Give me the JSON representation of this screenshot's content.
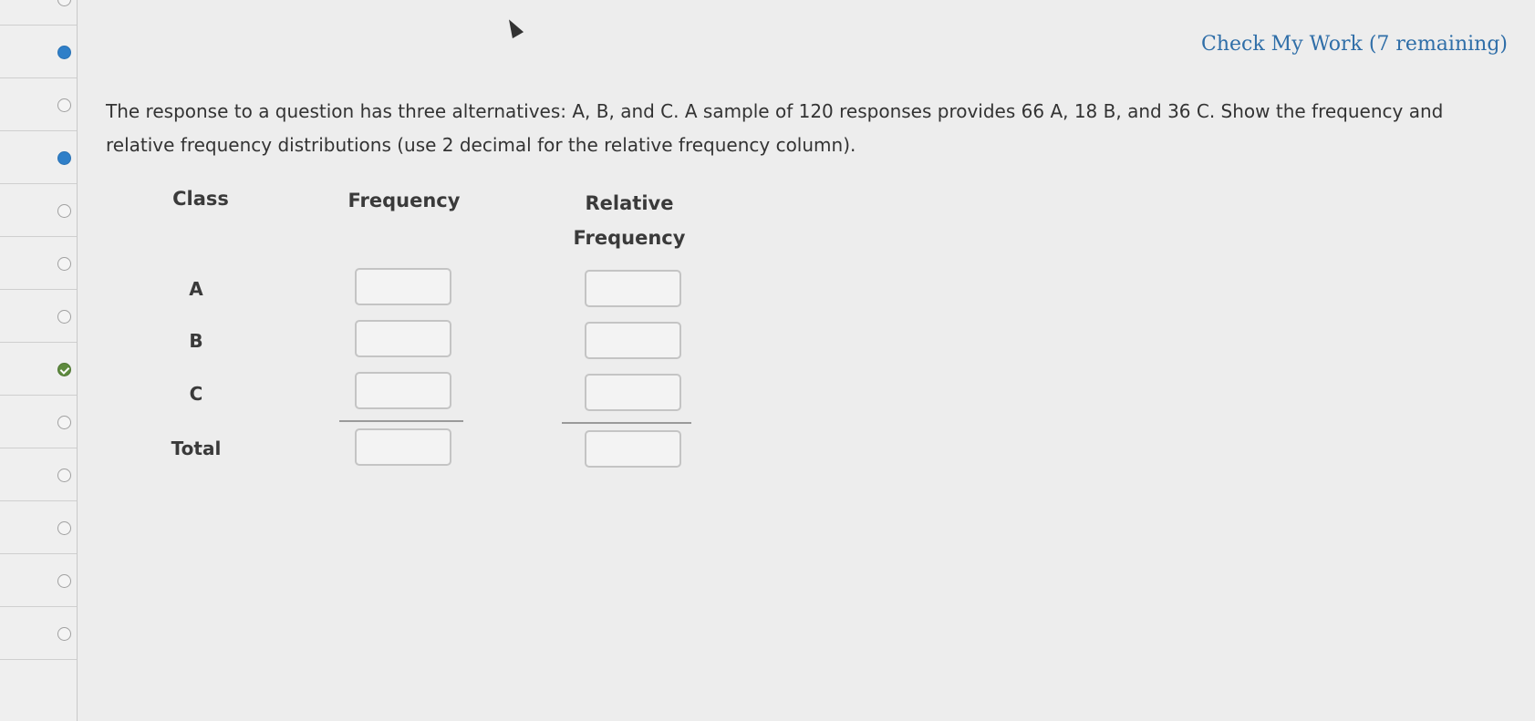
{
  "header": {
    "check_my_work": "Check My Work (7 remaining)"
  },
  "sidebar": {
    "items": [
      {
        "status": "empty"
      },
      {
        "status": "dot"
      },
      {
        "status": "empty"
      },
      {
        "status": "dot"
      },
      {
        "status": "empty"
      },
      {
        "status": "empty"
      },
      {
        "status": "empty"
      },
      {
        "status": "check"
      },
      {
        "status": "empty"
      },
      {
        "status": "empty"
      },
      {
        "status": "empty"
      },
      {
        "status": "empty"
      },
      {
        "status": "empty"
      }
    ]
  },
  "question": {
    "text": "The response to a question has three alternatives: A, B, and C. A sample of 120 responses provides 66 A, 18 B, and 36 C. Show the frequency and relative frequency distributions (use 2 decimal for the relative frequency column)."
  },
  "table": {
    "col_class": "Class",
    "col_frequency": "Frequency",
    "col_relative_line1": "Relative",
    "col_relative_line2": "Frequency",
    "rows": [
      "A",
      "B",
      "C"
    ],
    "total_label": "Total",
    "frequency_values": [
      "",
      "",
      "",
      ""
    ],
    "relative_values": [
      "",
      "",
      "",
      ""
    ]
  },
  "colors": {
    "link": "#2f6ea8",
    "dot": "#2f7fc8",
    "check": "#5e8a3e"
  }
}
